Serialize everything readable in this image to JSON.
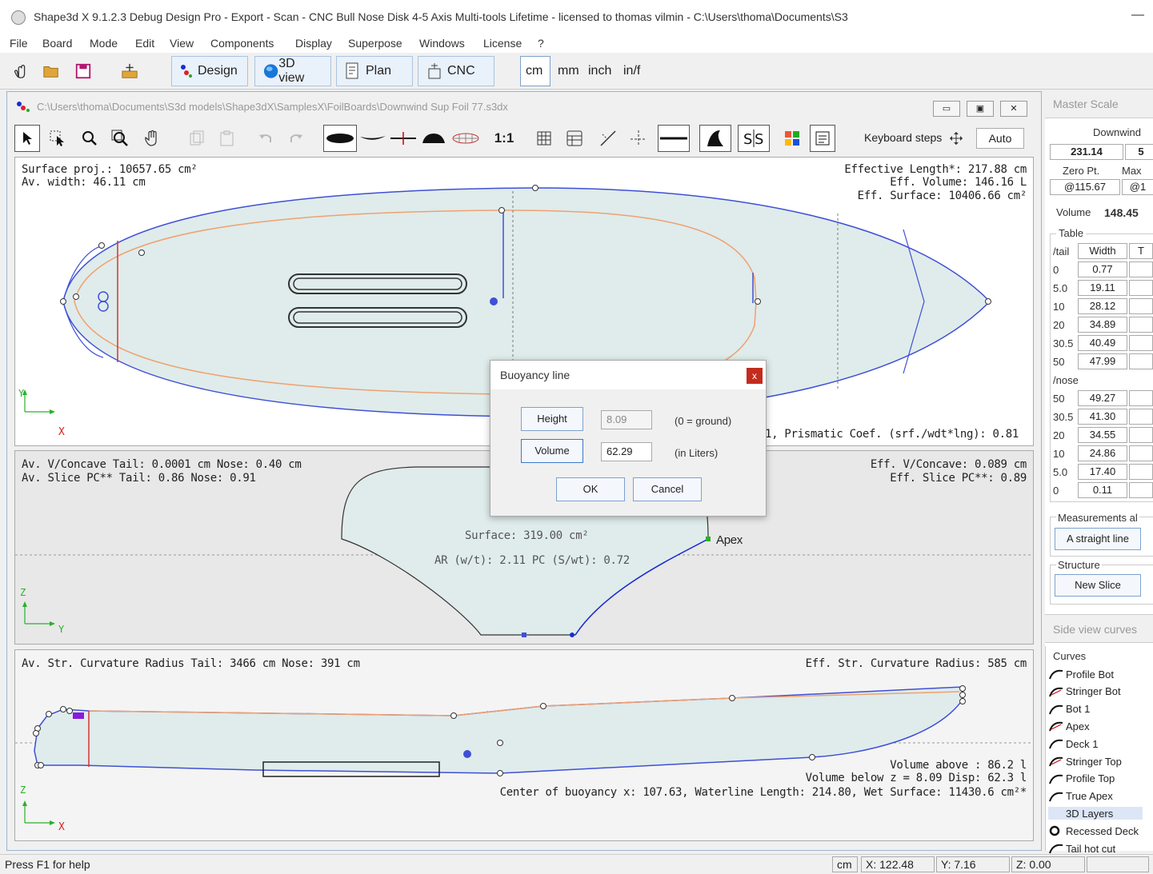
{
  "window": {
    "title": "Shape3d X 9.1.2.3 Debug Design Pro - Export - Scan - CNC Bull Nose Disk 4-5 Axis Multi-tools Lifetime - licensed to thomas vilmin - C:\\Users\\thoma\\Documents\\S3",
    "minimize": "—"
  },
  "menu": [
    "File",
    "Board",
    "Mode",
    "Edit",
    "View",
    "Components",
    "Display",
    "Superpose",
    "Windows",
    "License",
    "?"
  ],
  "toolbar": {
    "design": "Design",
    "view3d": "3D view",
    "plan": "Plan",
    "cnc": "CNC",
    "units": [
      "cm",
      "mm",
      "inch",
      "in/f"
    ],
    "selected_unit": "cm"
  },
  "document": {
    "path": "C:\\Users\\thoma\\Documents\\S3d models\\Shape3dX\\SamplesX\\FoilBoards\\Downwind Sup Foil 77.s3dx",
    "ratio": "1:1",
    "keyboard_steps": "Keyboard steps",
    "auto": "Auto"
  },
  "top_view": {
    "surface_proj": "Surface proj.: 10657.65 cm²",
    "av_width": "Av. width: 46.11 cm",
    "eff_length": "Effective Length*: 217.88 cm",
    "eff_volume": "Eff. Volume: 146.16 L",
    "eff_surface": "Eff. Surface: 10406.66 cm²",
    "prismatic": "): 5.01, Prismatic Coef. (srf./wdt*lng): 0.81",
    "axis_x": "X",
    "axis_y": "Y"
  },
  "mid_view": {
    "av_concave": "Av. V/Concave Tail: 0.0001 cm Nose: 0.40 cm",
    "av_slice_pc": "Av. Slice PC** Tail:  0.86 Nose:  0.91",
    "eff_concave": "Eff. V/Concave: 0.089 cm",
    "eff_slice_pc": "Eff. Slice PC**:  0.89",
    "surface": "Surface: 319.00 cm²",
    "ar": "AR (w/t): 2.11 PC (S/wt): 0.72",
    "apex": "Apex",
    "axis_z": "Z",
    "axis_y": "Y"
  },
  "bot_view": {
    "av_curvature": "Av. Str. Curvature Radius Tail: 3466 cm Nose: 391 cm",
    "eff_curvature": "Eff. Str. Curvature Radius: 585 cm",
    "volume_above": "Volume above :  86.2 l",
    "volume_below": "Volume below z = 8.09 Disp:  62.3 l",
    "center_buoyancy": "Center of buoyancy x: 107.63, Waterline Length: 214.80, Wet Surface: 11430.6 cm²*",
    "axis_z": "Z",
    "axis_x": "X"
  },
  "right_panel": {
    "master_scale": "Master Scale",
    "downwind": "Downwind",
    "length_value": "231.14",
    "next_value": "5",
    "zero_pt": "Zero Pt.",
    "max": "Max",
    "zero_val": "@115.67",
    "max_val": "@1",
    "volume_label": "Volume",
    "volume_value": "148.45",
    "table_label": "Table",
    "col_tail": "/tail",
    "col_width": "Width",
    "col_t": "T",
    "tail_rows": [
      {
        "pos": "0",
        "width": "0.77"
      },
      {
        "pos": "5.0",
        "width": "19.11"
      },
      {
        "pos": "10",
        "width": "28.12"
      },
      {
        "pos": "20",
        "width": "34.89"
      },
      {
        "pos": "30.5",
        "width": "40.49"
      },
      {
        "pos": "50",
        "width": "47.99"
      }
    ],
    "nose_label": "/nose",
    "nose_rows": [
      {
        "pos": "50",
        "width": "49.27"
      },
      {
        "pos": "30.5",
        "width": "41.30"
      },
      {
        "pos": "20",
        "width": "34.55"
      },
      {
        "pos": "10",
        "width": "24.86"
      },
      {
        "pos": "5.0",
        "width": "17.40"
      },
      {
        "pos": "0",
        "width": "0.11"
      }
    ],
    "measurements": "Measurements al",
    "straight_line": "A straight line",
    "structure": "Structure",
    "new_slice": "New Slice",
    "side_view_curves": "Side view curves",
    "curves_label": "Curves",
    "curves": [
      "Profile Bot",
      "Stringer Bot",
      "Bot 1",
      "Apex",
      "Deck 1",
      "Stringer Top",
      "Profile Top",
      "True Apex",
      "3D Layers",
      "Recessed Deck",
      "Tail hot cut"
    ]
  },
  "dialog": {
    "title": "Buoyancy line",
    "close": "x",
    "height_btn": "Height",
    "height_val": "8.09",
    "height_note": "(0 = ground)",
    "volume_btn": "Volume",
    "volume_val": "62.29",
    "volume_note": "(in Liters)",
    "ok": "OK",
    "cancel": "Cancel"
  },
  "status": {
    "help": "Press F1 for help",
    "unit": "cm",
    "x": "X: 122.48",
    "y": "Y: 7.16",
    "z": "Z: 0.00"
  },
  "colors": {
    "outline_blue": "#3f4fd6",
    "orange_curve": "#f0a070",
    "red_line": "#e03030",
    "board_fill": "#dfeceb",
    "dialog_close": "#c42b1c"
  }
}
